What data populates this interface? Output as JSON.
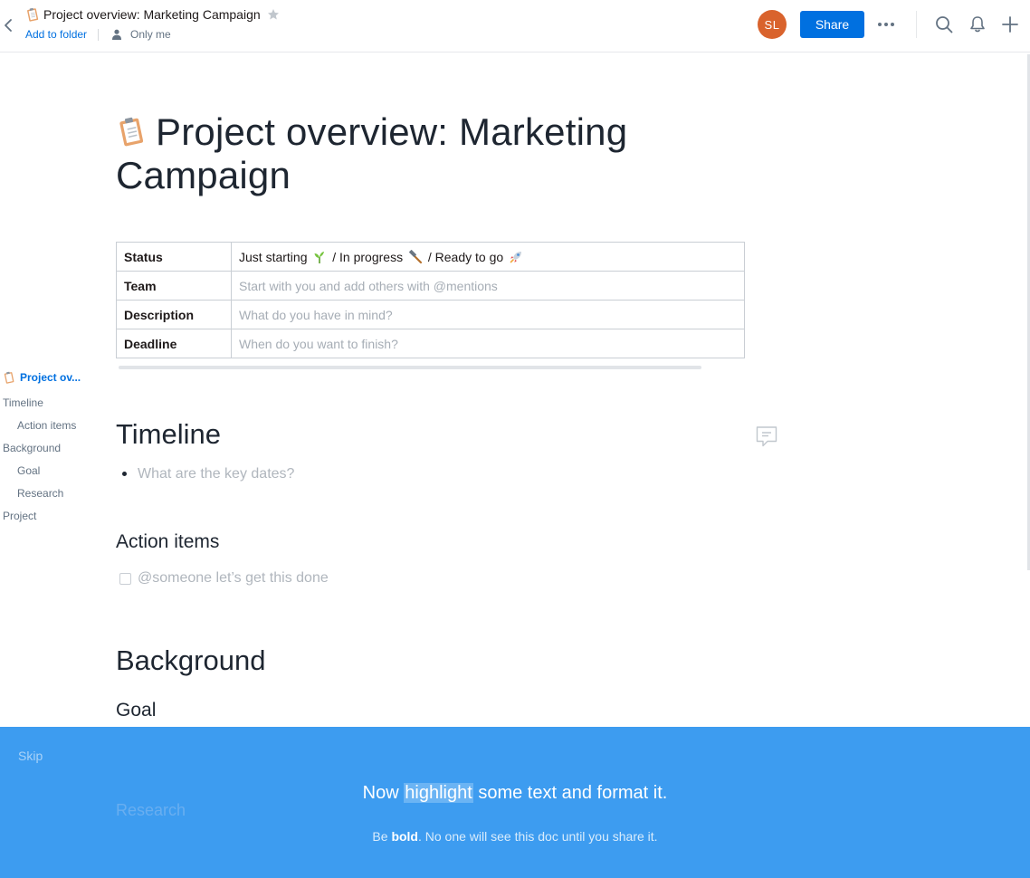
{
  "header": {
    "title": "Project overview: Marketing Campaign",
    "add_to_folder": "Add to folder",
    "sharing": "Only me",
    "avatar_initials": "SL",
    "share_label": "Share"
  },
  "document": {
    "title": "Project overview: Marketing Campaign",
    "table": [
      {
        "key": "Status",
        "value_parts": [
          "Just starting",
          "/ In progress",
          "/ Ready to go"
        ]
      },
      {
        "key": "Team",
        "placeholder": "Start with you and add others with @mentions"
      },
      {
        "key": "Description",
        "placeholder": "What do you have in mind?"
      },
      {
        "key": "Deadline",
        "placeholder": "When do you want to finish?"
      }
    ],
    "timeline_heading": "Timeline",
    "timeline_placeholder": "What are the key dates?",
    "action_items_heading": "Action items",
    "action_item_placeholder": "@someone let’s get this done",
    "background_heading": "Background",
    "goal_heading": "Goal",
    "research_heading": "Research"
  },
  "toc": {
    "active": "Project ov...",
    "items": [
      "Timeline",
      "Action items",
      "Background",
      "Goal",
      "Research",
      "Project"
    ]
  },
  "onboarding": {
    "skip": "Skip",
    "line_before": "Now",
    "line_highlight": "highlight",
    "line_after": "some text and format it.",
    "sub_before": "Be",
    "sub_bold": "bold",
    "sub_after": ". No one will see this doc until you share it."
  },
  "colors": {
    "accent": "#0070e0",
    "overlay": "#3d9cf0",
    "avatar": "#d9632d"
  }
}
